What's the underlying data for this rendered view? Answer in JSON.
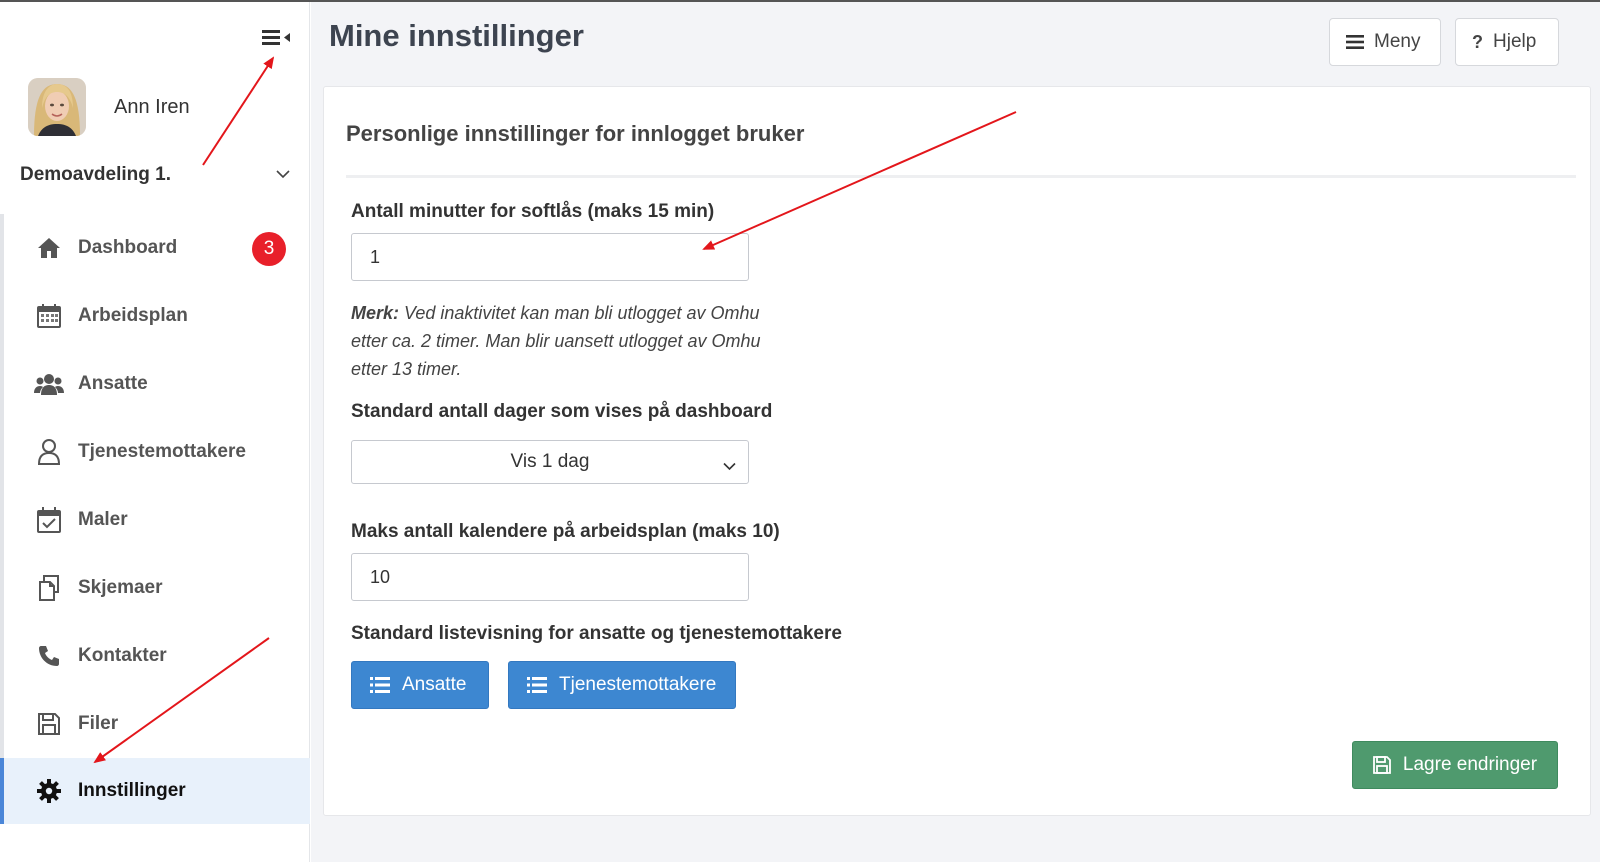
{
  "sidebar": {
    "user_name": "Ann Iren",
    "department": "Demoavdeling 1.",
    "items": [
      {
        "label": "Dashboard",
        "icon": "home-icon",
        "badge": "3"
      },
      {
        "label": "Arbeidsplan",
        "icon": "calendar-icon"
      },
      {
        "label": "Ansatte",
        "icon": "users-icon"
      },
      {
        "label": "Tjenestemottakere",
        "icon": "user-icon"
      },
      {
        "label": "Maler",
        "icon": "calendar-check-icon"
      },
      {
        "label": "Skjemaer",
        "icon": "copy-icon"
      },
      {
        "label": "Kontakter",
        "icon": "phone-icon"
      },
      {
        "label": "Filer",
        "icon": "save-icon"
      },
      {
        "label": "Innstillinger",
        "icon": "gear-icon",
        "active": true
      }
    ]
  },
  "header": {
    "title": "Mine innstillinger",
    "menu_label": "Meny",
    "help_label": "Hjelp"
  },
  "card": {
    "title": "Personlige innstillinger for innlogget bruker",
    "softlock_label": "Antall minutter for softlås (maks 15 min)",
    "softlock_value": "1",
    "note_bold": "Merk:",
    "note_text": "Ved inaktivitet kan man bli utlogget av Omhu etter ca. 2 timer. Man blir uansett utlogget av Omhu etter 13 timer.",
    "days_label": "Standard antall dager som vises på dashboard",
    "days_selected": "Vis 1 dag",
    "calendars_label": "Maks antall kalendere på arbeidsplan (maks 10)",
    "calendars_value": "10",
    "listview_label": "Standard listevisning for ansatte og tjenestemottakere",
    "btn_employees": "Ansatte",
    "btn_recipients": "Tjenestemottakere",
    "save_label": "Lagre endringer"
  },
  "colors": {
    "primary_button": "#3d87d1",
    "save_button": "#4f9a6e",
    "badge": "#e8202a",
    "active_nav": "#e8f1fb",
    "annotation_arrow": "#e3161b"
  }
}
